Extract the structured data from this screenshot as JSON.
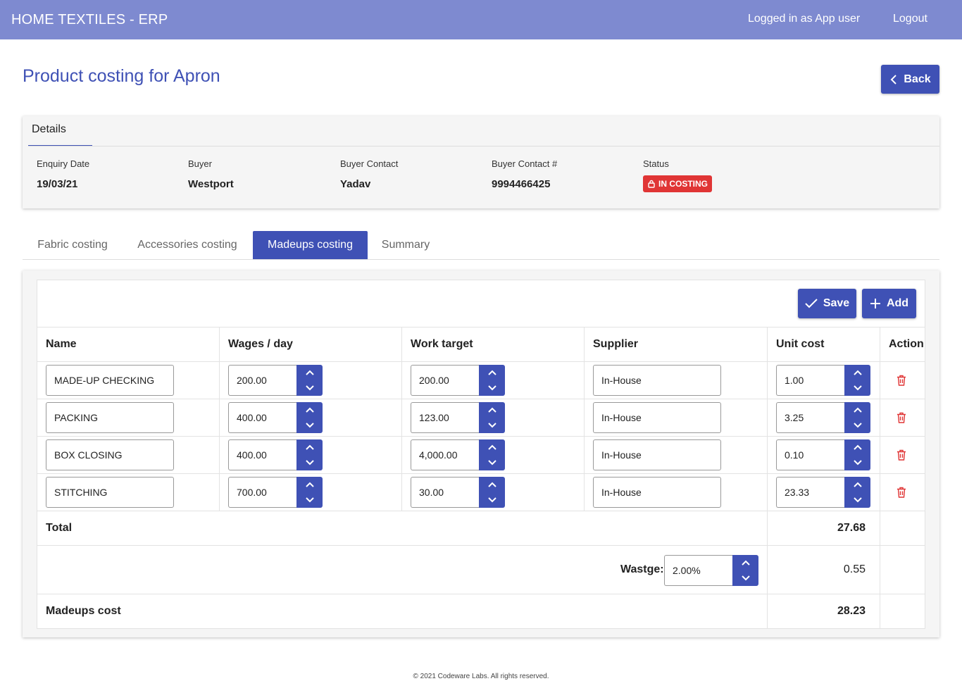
{
  "app": {
    "title": "HOME TEXTILES - ERP",
    "user": "Logged in as App user",
    "logout": "Logout"
  },
  "page": {
    "title": "Product costing for Apron",
    "back": "Back"
  },
  "details": {
    "tab": "Details",
    "enquiry_date": {
      "label": "Enquiry Date",
      "value": "19/03/21"
    },
    "buyer": {
      "label": "Buyer",
      "value": "Westport"
    },
    "buyer_contact": {
      "label": "Buyer Contact",
      "value": "Yadav"
    },
    "buyer_contact_no": {
      "label": "Buyer Contact #",
      "value": "9994466425"
    },
    "status": {
      "label": "Status",
      "value": "IN COSTING",
      "color": "#e03535"
    }
  },
  "tabs": [
    "Fabric costing",
    "Accessories costing",
    "Madeups costing",
    "Summary"
  ],
  "active_tab": "Madeups costing",
  "toolbar": {
    "save": "Save",
    "add": "Add"
  },
  "table": {
    "headers": [
      "Name",
      "Wages / day",
      "Work target",
      "Supplier",
      "Unit cost",
      "Action"
    ],
    "rows": [
      {
        "name": "MADE-UP CHECKING",
        "wages": "200.00",
        "target": "200.00",
        "supplier": "In-House",
        "unit_cost": "1.00"
      },
      {
        "name": "PACKING",
        "wages": "400.00",
        "target": "123.00",
        "supplier": "In-House",
        "unit_cost": "3.25"
      },
      {
        "name": "BOX CLOSING",
        "wages": "400.00",
        "target": "4,000.00",
        "supplier": "In-House",
        "unit_cost": "0.10"
      },
      {
        "name": "STITCHING",
        "wages": "700.00",
        "target": "30.00",
        "supplier": "In-House",
        "unit_cost": "23.33"
      }
    ]
  },
  "summary": {
    "total_label": "Total",
    "total_value": "27.68",
    "wastage_label": "Wastge:",
    "wastage_pct": "2.00%",
    "wastage_value": "0.55",
    "madeups_label": "Madeups cost",
    "madeups_value": "28.23"
  },
  "footer": "© 2021 Codeware Labs. All rights reserved.",
  "colors": {
    "primary": "#3f51b5",
    "topbar": "#7e8ad0",
    "danger": "#e03535"
  }
}
